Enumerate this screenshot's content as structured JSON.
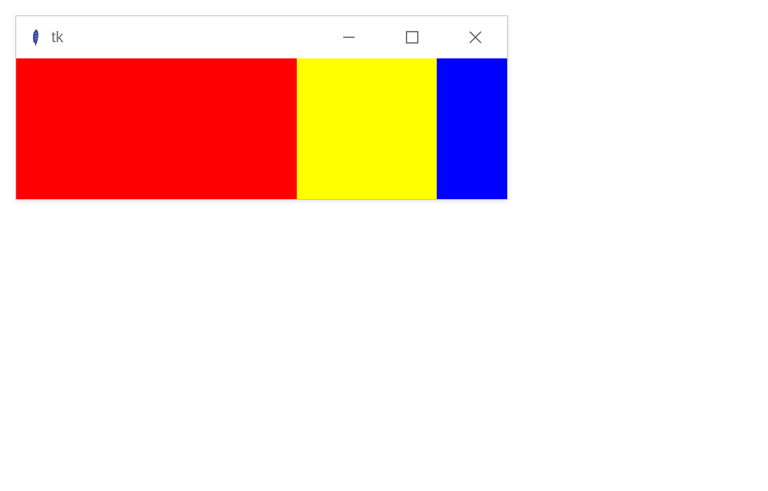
{
  "window": {
    "title": "tk",
    "icon": "feather-icon"
  },
  "controls": {
    "minimize": "minimize",
    "maximize": "maximize",
    "close": "close"
  },
  "panels": [
    {
      "name": "red-panel",
      "color": "#ff0000"
    },
    {
      "name": "yellow-panel",
      "color": "#ffff00"
    },
    {
      "name": "blue-panel",
      "color": "#0000ff"
    }
  ]
}
